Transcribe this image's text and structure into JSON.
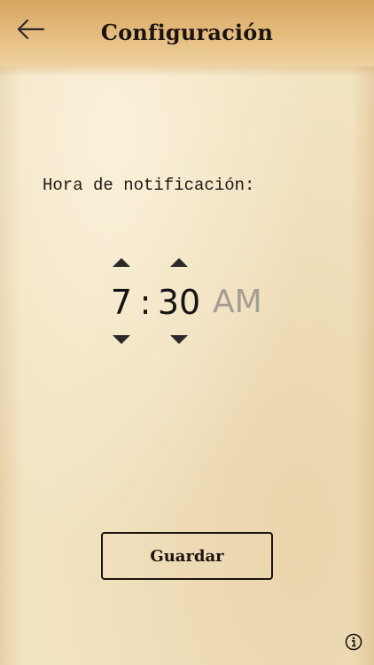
{
  "header": {
    "title": "Configuración",
    "back_icon": "arrow-left-icon"
  },
  "settings": {
    "notification_label": "Hora de notificación:"
  },
  "time_picker": {
    "hour": "7",
    "separator": ":",
    "minute": "30",
    "period": "AM",
    "up_icon": "triangle-up-icon",
    "down_icon": "triangle-down-icon"
  },
  "actions": {
    "save_label": "Guardar"
  },
  "footer": {
    "info_icon": "info-icon"
  },
  "colors": {
    "header_bg": "#dcae6a",
    "paper_bg": "#f2e3c1",
    "text": "#1a1410",
    "muted_period": "#a39d96"
  }
}
